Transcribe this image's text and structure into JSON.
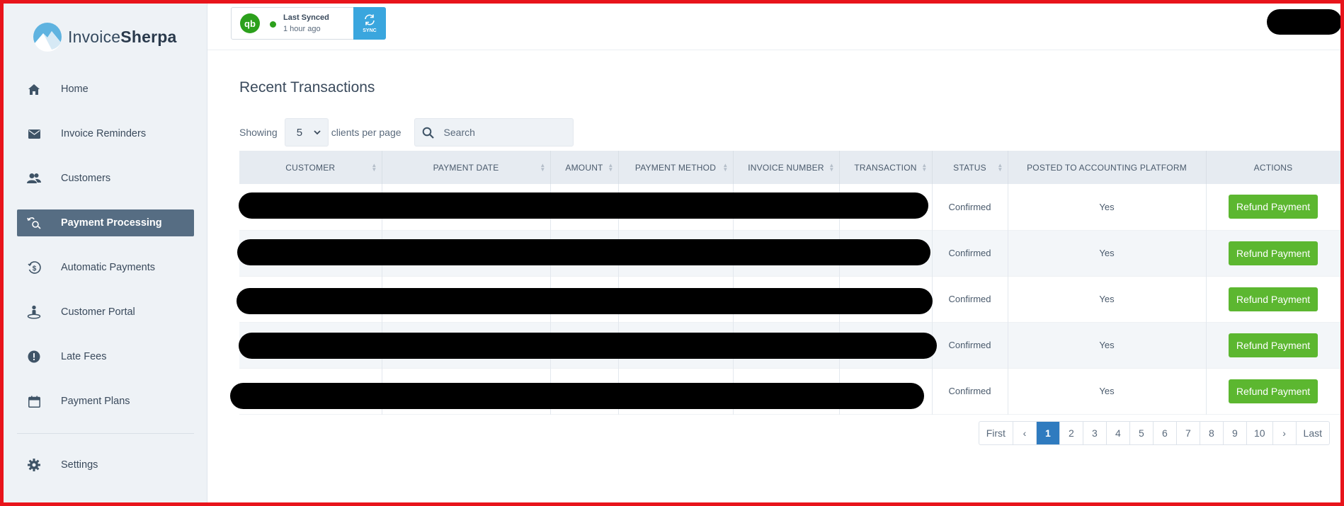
{
  "brand": {
    "name_light": "Invoice",
    "name_bold": "Sherpa"
  },
  "sidebar": {
    "items": [
      {
        "label": "Home",
        "icon": "home-icon"
      },
      {
        "label": "Invoice Reminders",
        "icon": "envelope-icon"
      },
      {
        "label": "Customers",
        "icon": "users-icon"
      },
      {
        "label": "Payment Processing",
        "icon": "payment-flow-icon",
        "active": true
      },
      {
        "label": "Automatic Payments",
        "icon": "dollar-cycle-icon"
      },
      {
        "label": "Customer Portal",
        "icon": "portal-person-icon"
      },
      {
        "label": "Late Fees",
        "icon": "alert-icon"
      },
      {
        "label": "Payment Plans",
        "icon": "calendar-icon"
      }
    ],
    "settings": {
      "label": "Settings",
      "icon": "gear-icon"
    }
  },
  "header": {
    "sync": {
      "title": "Last Synced",
      "subtitle": "1 hour ago",
      "button_label": "SYNC",
      "qb_logo": "qb"
    }
  },
  "main": {
    "title": "Recent Transactions",
    "showing_label": "Showing",
    "per_page_value": "5",
    "per_page_suffix": "clients per page",
    "search_placeholder": "Search",
    "columns": [
      "CUSTOMER",
      "PAYMENT DATE",
      "AMOUNT",
      "PAYMENT METHOD",
      "INVOICE NUMBER",
      "TRANSACTION",
      "STATUS",
      "POSTED TO ACCOUNTING PLATFORM",
      "ACTIONS"
    ],
    "rows": [
      {
        "status": "Confirmed",
        "posted": "Yes",
        "action": "Refund Payment"
      },
      {
        "status": "Confirmed",
        "posted": "Yes",
        "action": "Refund Payment"
      },
      {
        "status": "Confirmed",
        "posted": "Yes",
        "action": "Refund Payment"
      },
      {
        "status": "Confirmed",
        "posted": "Yes",
        "action": "Refund Payment"
      },
      {
        "status": "Confirmed",
        "posted": "Yes",
        "action": "Refund Payment"
      }
    ],
    "pagination": {
      "first": "First",
      "prev": "‹",
      "pages": [
        "1",
        "2",
        "3",
        "4",
        "5",
        "6",
        "7",
        "8",
        "9",
        "10"
      ],
      "active": "1",
      "next": "›",
      "last": "Last"
    }
  },
  "colors": {
    "sidebar_bg": "#eef2f6",
    "active_nav": "#566d83",
    "sync_button": "#3aa6de",
    "quickbooks_green": "#2ca01c",
    "refund_green": "#5cb730",
    "page_active": "#2f7bbf",
    "frame_border": "#e8141b"
  }
}
